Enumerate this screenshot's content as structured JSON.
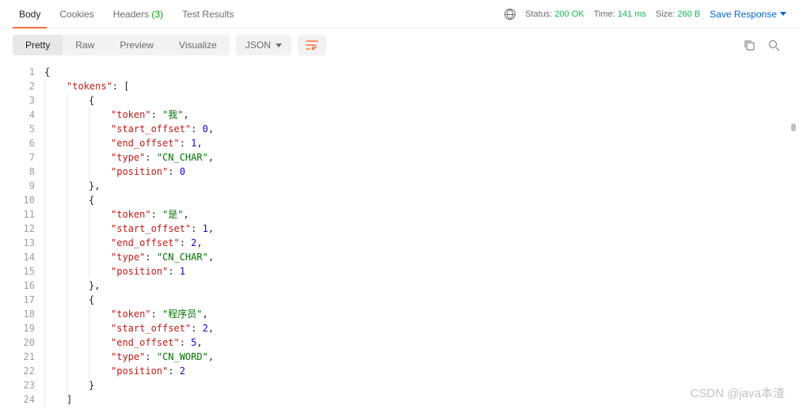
{
  "tabs": {
    "body": "Body",
    "cookies": "Cookies",
    "headers": "Headers",
    "headers_count": "(3)",
    "test_results": "Test Results"
  },
  "status": {
    "status_label": "Status:",
    "status_value": "200 OK",
    "time_label": "Time:",
    "time_value": "141 ms",
    "size_label": "Size:",
    "size_value": "260 B"
  },
  "save_response": "Save Response",
  "view_tabs": {
    "pretty": "Pretty",
    "raw": "Raw",
    "preview": "Preview",
    "visualize": "Visualize"
  },
  "format_dropdown": "JSON",
  "line_numbers": [
    "1",
    "2",
    "3",
    "4",
    "5",
    "6",
    "7",
    "8",
    "9",
    "10",
    "11",
    "12",
    "13",
    "14",
    "15",
    "16",
    "17",
    "18",
    "19",
    "20",
    "21",
    "22",
    "23",
    "24"
  ],
  "json_body": {
    "tokens_key": "\"tokens\"",
    "items": [
      {
        "token": "\"我\"",
        "start_offset": "0",
        "end_offset": "1",
        "type": "\"CN_CHAR\"",
        "position": "0"
      },
      {
        "token": "\"是\"",
        "start_offset": "1",
        "end_offset": "2",
        "type": "\"CN_CHAR\"",
        "position": "1"
      },
      {
        "token": "\"程序员\"",
        "start_offset": "2",
        "end_offset": "5",
        "type": "\"CN_WORD\"",
        "position": "2"
      }
    ],
    "keys": {
      "token": "\"token\"",
      "start_offset": "\"start_offset\"",
      "end_offset": "\"end_offset\"",
      "type": "\"type\"",
      "position": "\"position\""
    }
  },
  "watermark": "CSDN @java本渣"
}
